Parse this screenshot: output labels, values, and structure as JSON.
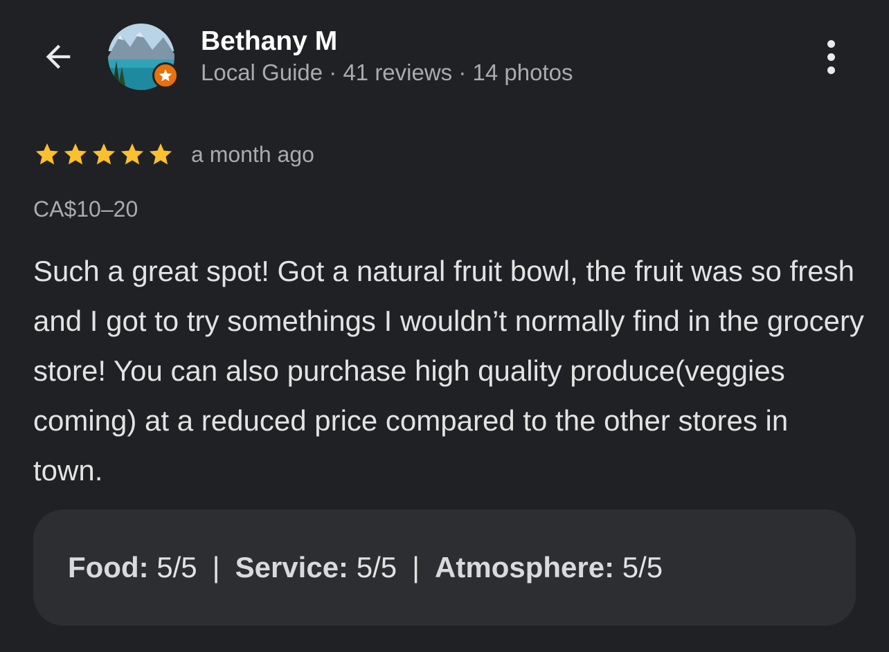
{
  "header": {
    "back_icon": "arrow-back-icon",
    "reviewer_name": "Bethany M",
    "reviewer_meta": "Local Guide · 41 reviews · 14 photos",
    "badge_icon": "local-guide-star-icon",
    "more_icon": "more-vertical-icon"
  },
  "review": {
    "rating": 5,
    "max_rating": 5,
    "star_color": "#fbc02d",
    "date": "a month ago",
    "price": "CA$10–20",
    "text": "Such a great spot! Got a natural fruit bowl, the fruit was so fresh and I got to try somethings I wouldn’t normally find in the grocery store! You can also purchase high quality produce(veggies coming) at a reduced price compared to the other stores in town."
  },
  "attributes": [
    {
      "label": "Food:",
      "value": "5/5"
    },
    {
      "label": "Service:",
      "value": "5/5"
    },
    {
      "label": "Atmosphere:",
      "value": "5/5"
    }
  ],
  "attribute_separator": "|",
  "colors": {
    "background": "#202124",
    "card": "#2d2e31",
    "badge": "#e8710a"
  }
}
